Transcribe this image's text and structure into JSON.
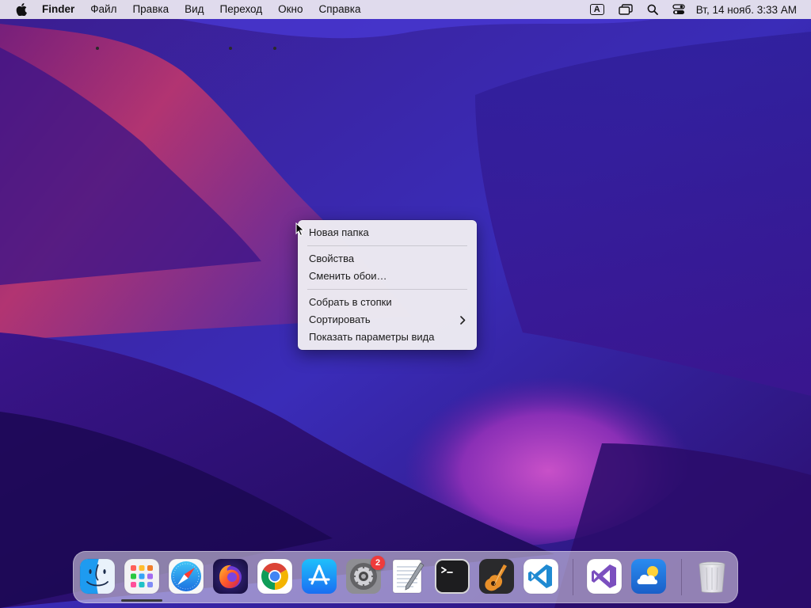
{
  "menubar": {
    "app_name": "Finder",
    "menus": [
      {
        "id": "file",
        "label": "Файл"
      },
      {
        "id": "edit",
        "label": "Правка"
      },
      {
        "id": "view",
        "label": "Вид"
      },
      {
        "id": "go",
        "label": "Переход"
      },
      {
        "id": "window",
        "label": "Окно"
      },
      {
        "id": "help",
        "label": "Справка"
      }
    ],
    "input_source": "A",
    "clock": "Вт, 14 нояб. 3:33 AM",
    "icons": [
      "apple-logo-icon",
      "input-source-icon",
      "screen-mirroring-icon",
      "spotlight-search-icon",
      "control-center-icon"
    ]
  },
  "context_menu": {
    "items": [
      {
        "id": "new-folder",
        "label": "Новая папка"
      },
      {
        "id": "get-info",
        "label": "Свойства"
      },
      {
        "id": "change-wallpaper",
        "label": "Сменить обои…"
      },
      {
        "id": "use-stacks",
        "label": "Собрать в стопки"
      },
      {
        "id": "sort-by",
        "label": "Сортировать",
        "submenu": true
      },
      {
        "id": "show-view-options",
        "label": "Показать параметры вида"
      }
    ]
  },
  "dock": {
    "apps": [
      {
        "name": "Finder",
        "icon": "finder-icon",
        "running": true
      },
      {
        "name": "Launchpad",
        "icon": "launchpad-icon",
        "running": false
      },
      {
        "name": "Safari",
        "icon": "safari-icon",
        "running": false
      },
      {
        "name": "Firefox",
        "icon": "firefox-icon",
        "running": true
      },
      {
        "name": "Chrome",
        "icon": "chrome-icon",
        "running": true
      },
      {
        "name": "App Store",
        "icon": "app-store-icon",
        "running": false
      },
      {
        "name": "System Preferences",
        "icon": "system-preferences-icon",
        "running": false,
        "badge": "2"
      },
      {
        "name": "TextEdit",
        "icon": "textedit-icon",
        "running": false
      },
      {
        "name": "Terminal",
        "icon": "terminal-icon",
        "running": false
      },
      {
        "name": "GarageBand",
        "icon": "garageband-icon",
        "running": false
      },
      {
        "name": "Visual Studio Code",
        "icon": "vscode-icon",
        "running": false
      },
      {
        "name": "Visual Studio",
        "icon": "visual-studio-icon",
        "running": false
      },
      {
        "name": "Weather",
        "icon": "weather-icon",
        "running": false
      },
      {
        "name": "Trash",
        "icon": "trash-icon",
        "running": false
      }
    ],
    "colors": {
      "chrome_red": "#db4437",
      "chrome_yellow": "#f4b400",
      "chrome_green": "#0f9d58",
      "chrome_blue": "#4285f4",
      "vscode_blue": "#1f8ad2",
      "visual_studio_purple": "#7b4fbf",
      "badge_red": "#ee3b3b"
    }
  }
}
